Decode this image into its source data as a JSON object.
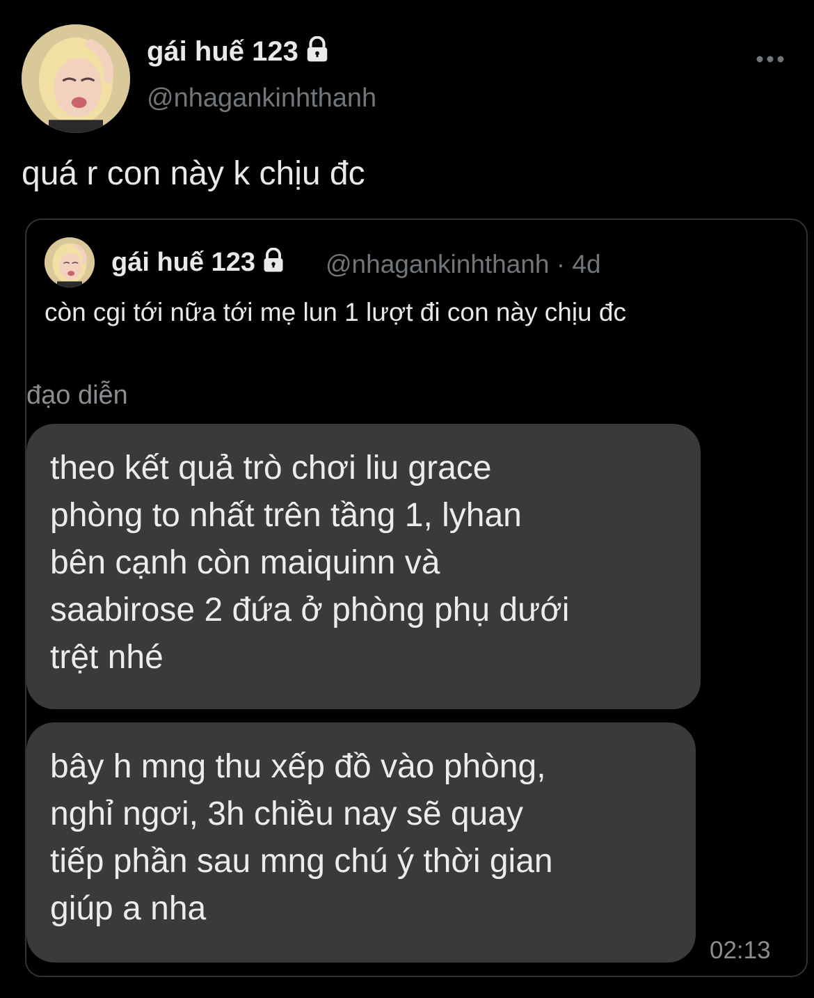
{
  "tweet": {
    "author": {
      "display_name": "gái huế 123",
      "handle": "@nhagankinhthanh",
      "verified_icon": "lock-icon",
      "avatar_icon": "avatar-icon"
    },
    "more_icon": "more-icon",
    "text": "quá r con này k chịu đc"
  },
  "quoted_tweet": {
    "author": {
      "display_name": "gái huế 123",
      "handle": "@nhagankinhthanh",
      "avatar_icon": "avatar-icon"
    },
    "meta": "@nhagankinhthanh · 4d",
    "text": "còn cgi tới nữa tới mẹ lun 1 lượt đi con này chịu đc",
    "image": {
      "sender": "đạo diễn",
      "messages": [
        "theo kết quả trò chơi liu grace\nphòng to nhất trên tầng 1, lyhan\nbên cạnh còn maiquinn và\nsaabirose 2 đứa ở phòng phụ dưới\ntrệt nhé",
        "bây h mng thu xếp đồ vào phòng,\nnghỉ ngơi, 3h chiều nay sẽ quay\ntiếp phần sau mng chú ý thời gian\ngiúp a nha"
      ],
      "timestamp": "02:13",
      "bubble_color": "#3a3a3c"
    }
  },
  "colors": {
    "background": "#000000",
    "text": "#e7e9ea",
    "secondary": "#71767b",
    "border": "#2f3336"
  }
}
